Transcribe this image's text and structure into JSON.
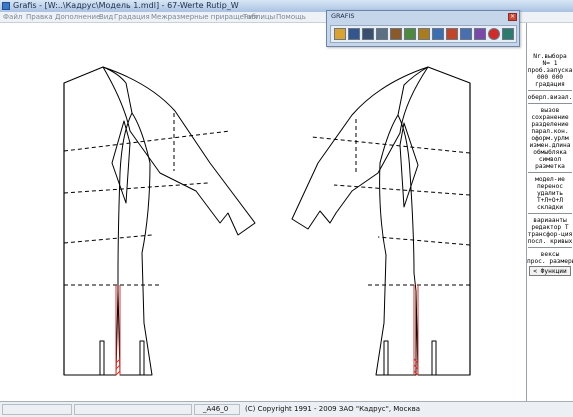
{
  "window": {
    "title": "Grafis - [W:..\\Кадрус\\Модель 1.mdl] - 67-Werte Rutip_W"
  },
  "menu": [
    "Файл",
    "Правка",
    "Дополнение",
    "Вид",
    "Градация",
    "Межразмерные приращения",
    "Таблицы",
    "Помощь"
  ],
  "palette": {
    "title": "GRAFIS",
    "tools": [
      {
        "name": "folder-open-icon",
        "color": "#d8a330"
      },
      {
        "name": "save-icon",
        "color": "#33568f"
      },
      {
        "name": "floppy-icon",
        "color": "#3b4f6f"
      },
      {
        "name": "search-icon",
        "color": "#5d6f82"
      },
      {
        "name": "measure-icon",
        "color": "#8b5a2b"
      },
      {
        "name": "table-icon",
        "color": "#4e8a3d"
      },
      {
        "name": "ruler-icon",
        "color": "#a97d1e"
      },
      {
        "name": "globe-icon",
        "color": "#3d6fb0"
      },
      {
        "name": "scissors-icon",
        "color": "#c2452a"
      },
      {
        "name": "download-icon",
        "color": "#4a6fb0"
      },
      {
        "name": "export-icon",
        "color": "#7b4aa8"
      },
      {
        "name": "stop-icon",
        "color": "#d12c2c"
      },
      {
        "name": "monitor-icon",
        "color": "#2f7a6e"
      }
    ]
  },
  "sidebar": {
    "items": [
      "Nr.выбора",
      "N= 1",
      "проб.запуска",
      "000 000",
      "градация",
      "оберл.визал.",
      "вызов",
      "сохранение",
      "разделение",
      "парал.кон.",
      "оформ.урлм",
      "измен.длина",
      "обмыбляка",
      "символ",
      "разметка",
      "модел-ие",
      "перенос",
      "удалить",
      "Т+Л+О+Л",
      "складки",
      "вариаанты",
      "редактор Т",
      "трансфор-ция",
      "посл. кривых",
      "вексы",
      "прос. размеры"
    ],
    "func_button": "< Функции"
  },
  "status": {
    "field_left": "",
    "field_mid": "",
    "code": "_A46_0",
    "copyright": "(C) Copyright 1991 - 2009 ЗАО \"Кадрус\", Москва"
  },
  "colors": {
    "accent_red": "#d9302a",
    "pattern_line": "#000000"
  }
}
